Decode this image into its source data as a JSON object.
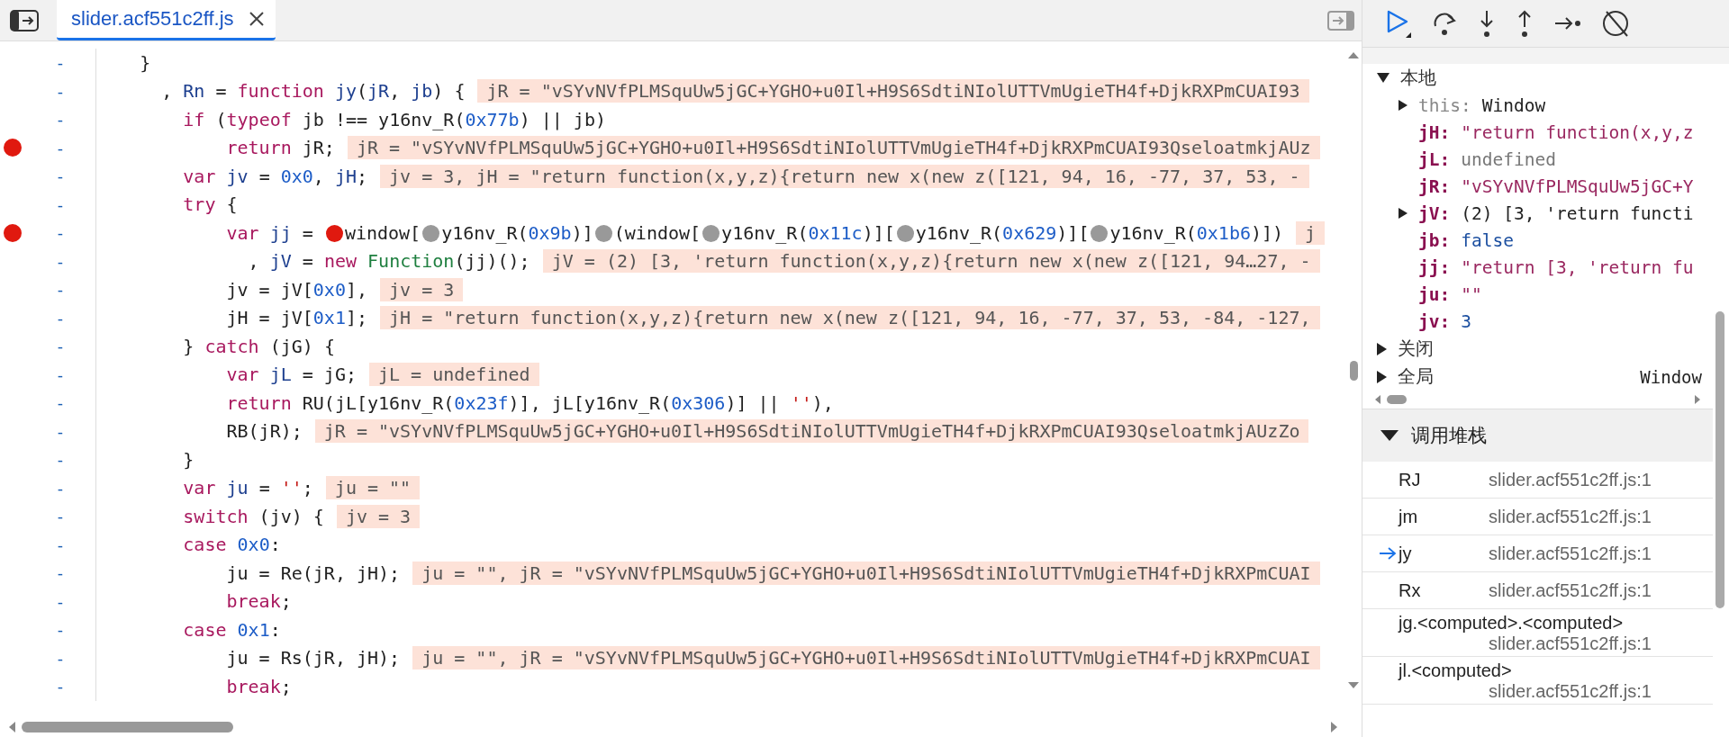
{
  "tab": {
    "label": "slider.acf551c2ff.js",
    "selected": true
  },
  "code": {
    "lines": [
      {
        "number": "-",
        "breakpoint": false,
        "tokens": [
          {
            "kind": "plain",
            "text": "}"
          }
        ]
      },
      {
        "number": "-",
        "breakpoint": false,
        "tokens": [
          {
            "kind": "plain",
            "text": "  , "
          },
          {
            "kind": "name",
            "text": "Rn"
          },
          {
            "kind": "plain",
            "text": " = "
          },
          {
            "kind": "keyword",
            "text": "function "
          },
          {
            "kind": "name",
            "text": "jy"
          },
          {
            "kind": "plain",
            "text": "("
          },
          {
            "kind": "name",
            "text": "jR"
          },
          {
            "kind": "plain",
            "text": ", "
          },
          {
            "kind": "name",
            "text": "jb"
          },
          {
            "kind": "plain",
            "text": ") {"
          }
        ],
        "inline": "jR = \"vSYvNVfPLMSquUw5jGC+YGHO+u0Il+H9S6SdtiNIolUTTVmUgieTH4f+DjkRXPmCUAI93",
        "children": [
          {
            "number": "-",
            "breakpoint": false,
            "tokens": [
              {
                "kind": "keyword",
                "text": "if"
              },
              {
                "kind": "plain",
                "text": " ("
              },
              {
                "kind": "keyword",
                "text": "typeof"
              },
              {
                "kind": "plain",
                "text": " jb !== y16nv_R("
              },
              {
                "kind": "number",
                "text": "0x77b"
              },
              {
                "kind": "plain",
                "text": ") || jb)"
              }
            ],
            "children": [
              {
                "number": "-",
                "breakpoint": true,
                "tokens": [
                  {
                    "kind": "keyword",
                    "text": "return"
                  },
                  {
                    "kind": "plain",
                    "text": " jR;"
                  }
                ],
                "inline": "jR = \"vSYvNVfPLMSquUw5jGC+YGHO+u0Il+H9S6SdtiNIolUTTVmUgieTH4f+DjkRXPmCUAI93QseloatmkjAUz"
              }
            ]
          },
          {
            "number": "-",
            "breakpoint": false,
            "tokens": [
              {
                "kind": "keyword",
                "text": "var "
              },
              {
                "kind": "name",
                "text": "jv"
              },
              {
                "kind": "plain",
                "text": " = "
              },
              {
                "kind": "number",
                "text": "0x0"
              },
              {
                "kind": "plain",
                "text": ", "
              },
              {
                "kind": "name",
                "text": "jH"
              },
              {
                "kind": "plain",
                "text": ";"
              }
            ],
            "inline": "jv = 3, jH = \"return function(x,y,z){return new x(new z([121, 94, 16, -77, 37, 53, -"
          },
          {
            "number": "-",
            "breakpoint": false,
            "tokens": [
              {
                "kind": "keyword",
                "text": "try"
              },
              {
                "kind": "plain",
                "text": " {"
              }
            ],
            "children": [
              {
                "number": "-",
                "breakpoint": true,
                "tokens": [
                  {
                    "kind": "keyword",
                    "text": "var "
                  },
                  {
                    "kind": "name",
                    "text": "jj"
                  },
                  {
                    "kind": "plain",
                    "text": " = "
                  },
                  {
                    "kind": "marker",
                    "active": true
                  },
                  {
                    "kind": "plain",
                    "text": "window["
                  },
                  {
                    "kind": "marker",
                    "active": false
                  },
                  {
                    "kind": "plain",
                    "text": "y16nv_R("
                  },
                  {
                    "kind": "number",
                    "text": "0x9b"
                  },
                  {
                    "kind": "plain",
                    "text": ")]"
                  },
                  {
                    "kind": "marker",
                    "active": false
                  },
                  {
                    "kind": "plain",
                    "text": "(window["
                  },
                  {
                    "kind": "marker",
                    "active": false
                  },
                  {
                    "kind": "plain",
                    "text": "y16nv_R("
                  },
                  {
                    "kind": "number",
                    "text": "0x11c"
                  },
                  {
                    "kind": "plain",
                    "text": ")]["
                  },
                  {
                    "kind": "marker",
                    "active": false
                  },
                  {
                    "kind": "plain",
                    "text": "y16nv_R("
                  },
                  {
                    "kind": "number",
                    "text": "0x629"
                  },
                  {
                    "kind": "plain",
                    "text": ")]["
                  },
                  {
                    "kind": "marker",
                    "active": false
                  },
                  {
                    "kind": "plain",
                    "text": "y16nv_R("
                  },
                  {
                    "kind": "number",
                    "text": "0x1b6"
                  },
                  {
                    "kind": "plain",
                    "text": ")])"
                  }
                ],
                "inline": "j"
              },
              {
                "number": "-",
                "breakpoint": false,
                "tokens": [
                  {
                    "kind": "plain",
                    "text": "  , "
                  },
                  {
                    "kind": "name",
                    "text": "jV"
                  },
                  {
                    "kind": "plain",
                    "text": " = "
                  },
                  {
                    "kind": "keyword",
                    "text": "new "
                  },
                  {
                    "kind": "builtin",
                    "text": "Function"
                  },
                  {
                    "kind": "plain",
                    "text": "(jj)();"
                  }
                ],
                "inline": "jV = (2) [3, 'return function(x,y,z){return new x(new z([121, 94…27, -"
              },
              {
                "number": "-",
                "breakpoint": false,
                "tokens": [
                  {
                    "kind": "plain",
                    "text": "jv = jV["
                  },
                  {
                    "kind": "number",
                    "text": "0x0"
                  },
                  {
                    "kind": "plain",
                    "text": "],"
                  }
                ],
                "inline": "jv = 3"
              },
              {
                "number": "-",
                "breakpoint": false,
                "tokens": [
                  {
                    "kind": "plain",
                    "text": "jH = jV["
                  },
                  {
                    "kind": "number",
                    "text": "0x1"
                  },
                  {
                    "kind": "plain",
                    "text": "];"
                  }
                ],
                "inline": "jH = \"return function(x,y,z){return new x(new z([121, 94, 16, -77, 37, 53, -84, -127,"
              }
            ]
          },
          {
            "number": "-",
            "breakpoint": false,
            "tokens": [
              {
                "kind": "plain",
                "text": "} "
              },
              {
                "kind": "keyword",
                "text": "catch"
              },
              {
                "kind": "plain",
                "text": " (jG) {"
              }
            ],
            "children": [
              {
                "number": "-",
                "breakpoint": false,
                "tokens": [
                  {
                    "kind": "keyword",
                    "text": "var "
                  },
                  {
                    "kind": "name",
                    "text": "jL"
                  },
                  {
                    "kind": "plain",
                    "text": " = jG;"
                  }
                ],
                "inline": "jL = undefined"
              },
              {
                "number": "-",
                "breakpoint": false,
                "tokens": [
                  {
                    "kind": "keyword",
                    "text": "return"
                  },
                  {
                    "kind": "plain",
                    "text": " RU(jL[y16nv_R("
                  },
                  {
                    "kind": "number",
                    "text": "0x23f"
                  },
                  {
                    "kind": "plain",
                    "text": ")], jL[y16nv_R("
                  },
                  {
                    "kind": "number",
                    "text": "0x306"
                  },
                  {
                    "kind": "plain",
                    "text": ")] || "
                  },
                  {
                    "kind": "string",
                    "text": "''"
                  },
                  {
                    "kind": "plain",
                    "text": "),"
                  }
                ]
              },
              {
                "number": "-",
                "breakpoint": false,
                "tokens": [
                  {
                    "kind": "plain",
                    "text": "RB(jR);"
                  }
                ],
                "inline": "jR = \"vSYvNVfPLMSquUw5jGC+YGHO+u0Il+H9S6SdtiNIolUTTVmUgieTH4f+DjkRXPmCUAI93QseloatmkjAUzZo"
              }
            ]
          },
          {
            "number": "-",
            "breakpoint": false,
            "tokens": [
              {
                "kind": "plain",
                "text": "}"
              }
            ]
          },
          {
            "number": "-",
            "breakpoint": false,
            "tokens": [
              {
                "kind": "keyword",
                "text": "var "
              },
              {
                "kind": "name",
                "text": "ju"
              },
              {
                "kind": "plain",
                "text": " = "
              },
              {
                "kind": "string",
                "text": "''"
              },
              {
                "kind": "plain",
                "text": ";"
              }
            ],
            "inline": "ju = \"\""
          },
          {
            "number": "-",
            "breakpoint": false,
            "tokens": [
              {
                "kind": "keyword",
                "text": "switch"
              },
              {
                "kind": "plain",
                "text": " (jv) {"
              }
            ],
            "inline": "jv = 3"
          },
          {
            "number": "-",
            "breakpoint": false,
            "tokens": [
              {
                "kind": "keyword",
                "text": "case "
              },
              {
                "kind": "number",
                "text": "0x0"
              },
              {
                "kind": "plain",
                "text": ":"
              }
            ],
            "children": [
              {
                "number": "-",
                "breakpoint": false,
                "tokens": [
                  {
                    "kind": "plain",
                    "text": "ju = Re(jR, jH);"
                  }
                ],
                "inline": "ju = \"\", jR = \"vSYvNVfPLMSquUw5jGC+YGHO+u0Il+H9S6SdtiNIolUTTVmUgieTH4f+DjkRXPmCUAI"
              },
              {
                "number": "-",
                "breakpoint": false,
                "tokens": [
                  {
                    "kind": "keyword",
                    "text": "break"
                  },
                  {
                    "kind": "plain",
                    "text": ";"
                  }
                ]
              }
            ]
          },
          {
            "number": "-",
            "breakpoint": false,
            "tokens": [
              {
                "kind": "keyword",
                "text": "case "
              },
              {
                "kind": "number",
                "text": "0x1"
              },
              {
                "kind": "plain",
                "text": ":"
              }
            ],
            "children": [
              {
                "number": "-",
                "breakpoint": false,
                "tokens": [
                  {
                    "kind": "plain",
                    "text": "ju = Rs(jR, jH);"
                  }
                ],
                "inline": "ju = \"\", jR = \"vSYvNVfPLMSquUw5jGC+YGHO+u0Il+H9S6SdtiNIolUTTVmUgieTH4f+DjkRXPmCUAI"
              },
              {
                "number": "-",
                "breakpoint": false,
                "tokens": [
                  {
                    "kind": "keyword",
                    "text": "break"
                  },
                  {
                    "kind": "plain",
                    "text": ";"
                  }
                ]
              }
            ]
          }
        ]
      }
    ]
  },
  "scope": {
    "sections": [
      {
        "label": "本地",
        "expanded": true,
        "entries": [
          {
            "key": "this:",
            "value": "Window",
            "kind": "object",
            "internal": true,
            "expanded": false
          },
          {
            "key": "jH:",
            "value": "\"return function(x,y,z",
            "kind": "string",
            "internal": false
          },
          {
            "key": "jL:",
            "value": "undefined",
            "kind": "undefined",
            "internal": false
          },
          {
            "key": "jR:",
            "value": "\"vSYvNVfPLMSquUw5jGC+Y",
            "kind": "string",
            "internal": false
          },
          {
            "key": "jV:",
            "value": "(2) [3, 'return functi",
            "kind": "object",
            "internal": false,
            "expanded": false
          },
          {
            "key": "jb:",
            "value": "false",
            "kind": "boolean",
            "internal": false
          },
          {
            "key": "jj:",
            "value": "\"return [3, 'return fu",
            "kind": "string",
            "internal": false
          },
          {
            "key": "ju:",
            "value": "\"\"",
            "kind": "string",
            "internal": false
          },
          {
            "key": "jv:",
            "value": "3",
            "kind": "number",
            "internal": false
          }
        ]
      },
      {
        "label": "关闭",
        "expanded": false
      },
      {
        "label": "全局",
        "expanded": false,
        "value": "Window"
      }
    ]
  },
  "call_stack": {
    "title": "调用堆栈",
    "expanded": true,
    "frames": [
      {
        "name": "RJ",
        "location": "slider.acf551c2ff.js:1",
        "selected": false
      },
      {
        "name": "jm",
        "location": "slider.acf551c2ff.js:1",
        "selected": false
      },
      {
        "name": "jy",
        "location": "slider.acf551c2ff.js:1",
        "selected": true
      },
      {
        "name": "Rx",
        "location": "slider.acf551c2ff.js:1",
        "selected": false
      },
      {
        "name": "jg.<computed>.<computed>",
        "location": "slider.acf551c2ff.js:1",
        "selected": false
      },
      {
        "name": "jl.<computed>",
        "location": "slider.acf551c2ff.js:1",
        "selected": false
      }
    ]
  }
}
